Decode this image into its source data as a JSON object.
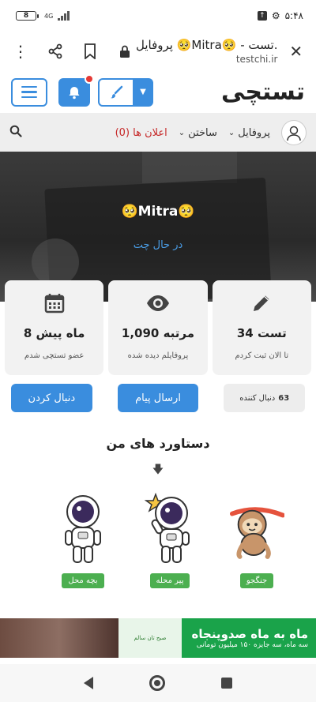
{
  "status_bar": {
    "battery": "8",
    "network": "4G",
    "time": "۵:۴۸"
  },
  "browser": {
    "page_title": "پروفایل 🥺Mitra🥺 - تست.",
    "url": "testchi.ir"
  },
  "header": {
    "logo": "تستچی"
  },
  "nav": {
    "items": [
      {
        "label": "پروفایل"
      },
      {
        "label": "ساختن"
      },
      {
        "label": "اعلان ها (0)"
      }
    ]
  },
  "profile": {
    "name": "🥺Mitra🥺",
    "status": "در حال چت"
  },
  "stats": [
    {
      "icon": "pencil-icon",
      "value": "34 تست",
      "label": "تا الان ثبت کردم"
    },
    {
      "icon": "eye-icon",
      "value": "1,090 مرتبه",
      "label": "پروفایلم دیده شده"
    },
    {
      "icon": "calendar-icon",
      "value": "8 ماه پیش",
      "label": "عضو تستچی شدم"
    }
  ],
  "actions": {
    "followers_count": "63",
    "followers_label": "دنبال کننده",
    "message_label": "ارسال پیام",
    "follow_label": "دنبال کردن"
  },
  "achievements": {
    "title": "دستاورد های من",
    "badges": [
      {
        "label": "جنگجو"
      },
      {
        "label": "پیر محله"
      },
      {
        "label": "بچه محل"
      }
    ]
  },
  "ad": {
    "headline": "ماه به ماه صدوپنجاه",
    "subline": "سه ماه، سه جایزه ۱۵۰ میلیون تومانی",
    "middle": "صبح تان سالم"
  },
  "colors": {
    "accent": "#3a8dde",
    "badge_green": "#4caf50",
    "alert_red": "#e53935"
  }
}
